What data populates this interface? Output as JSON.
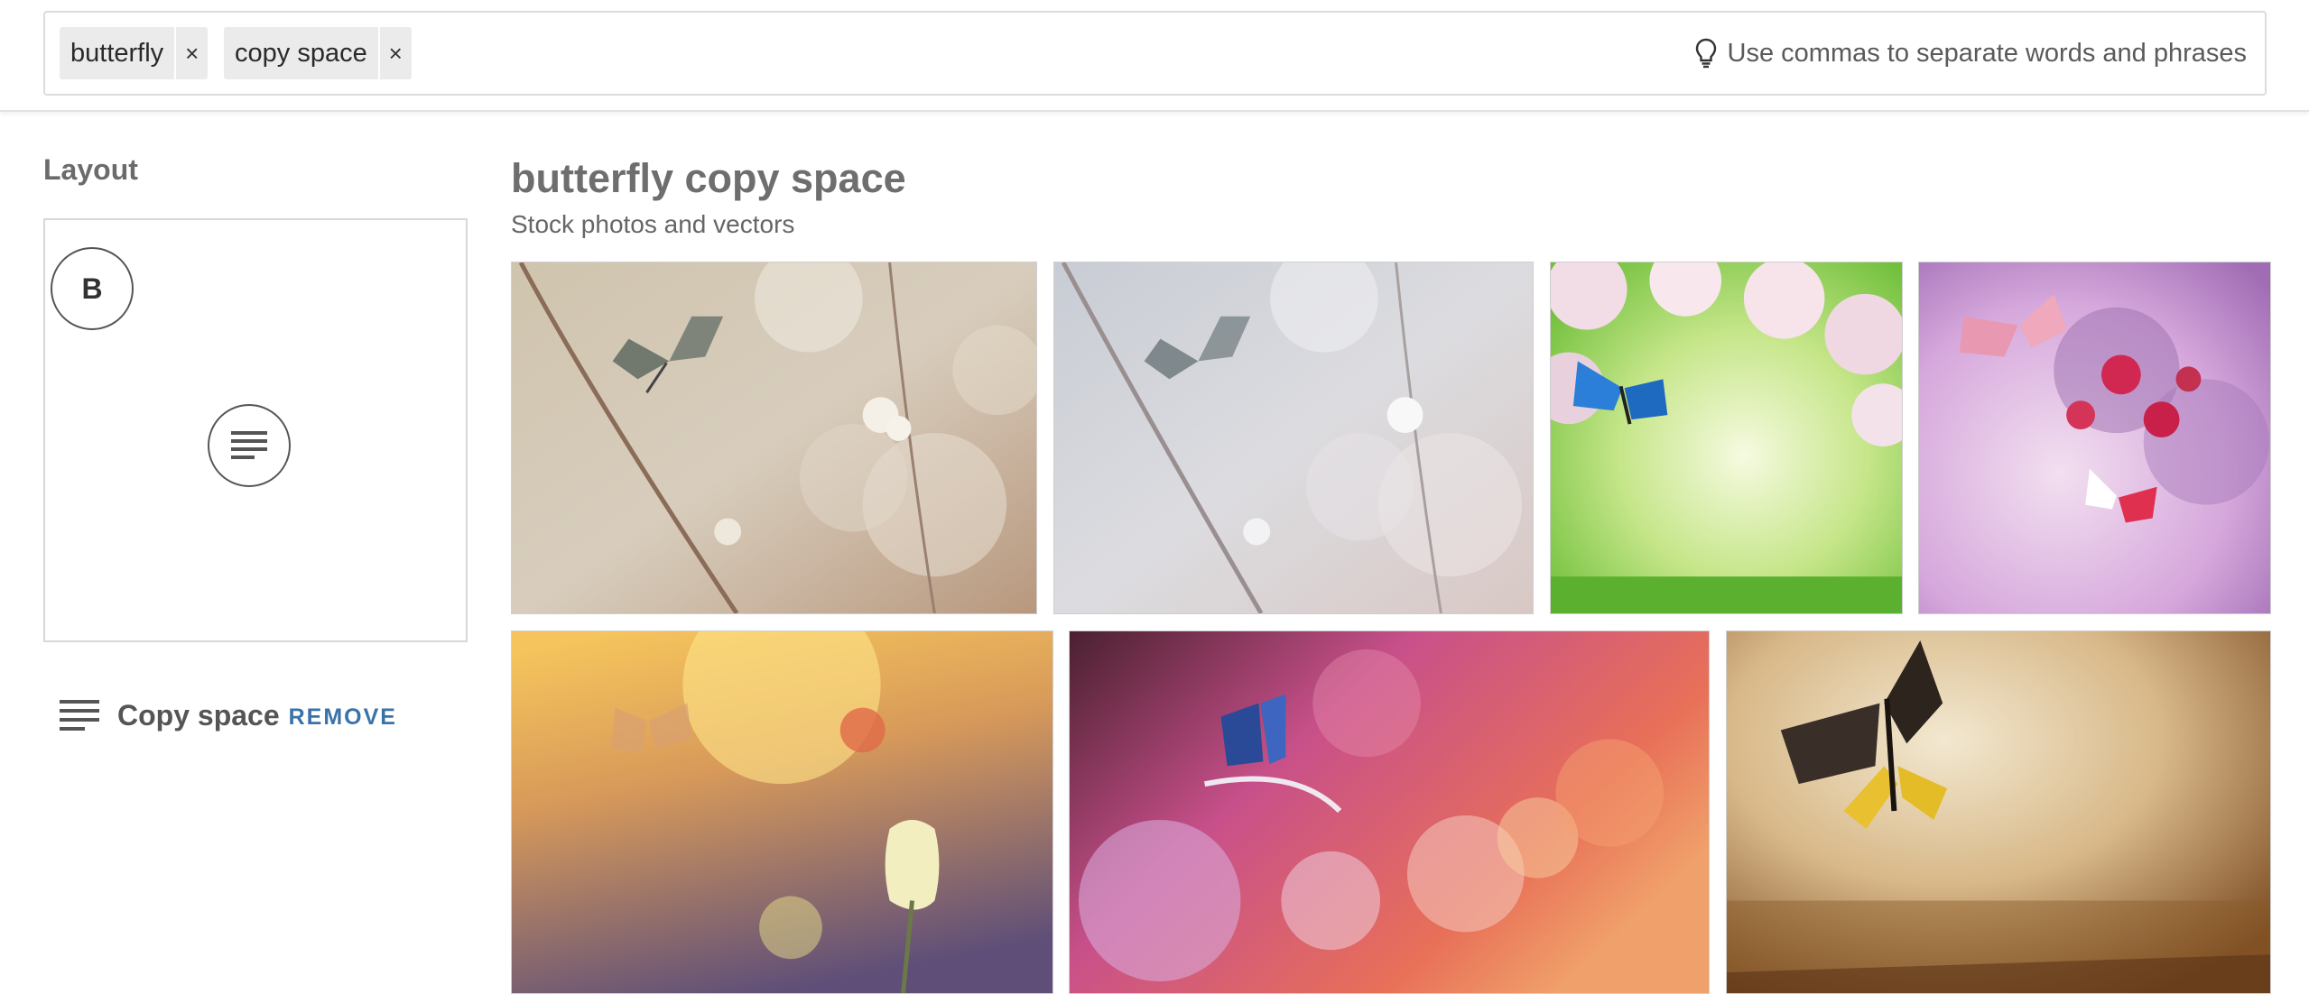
{
  "search": {
    "chips": [
      {
        "label": "butterfly",
        "remove": "×"
      },
      {
        "label": "copy space",
        "remove": "×"
      }
    ],
    "hint": "Use commas to separate words and phrases",
    "hint_icon": "lightbulb-icon"
  },
  "sidebar": {
    "layout_title": "Layout",
    "circle_b_label": "B",
    "copy_space_label": "Copy space",
    "remove_label": "REMOVE"
  },
  "main": {
    "title": "butterfly copy space",
    "subtitle": "Stock photos and vectors"
  },
  "images": [
    {
      "name": "butterfly-branch-warm",
      "desc": "butterfly on blossom branch, beige bokeh"
    },
    {
      "name": "butterfly-branch-cool",
      "desc": "butterfly on blossom branch, pale blue bokeh"
    },
    {
      "name": "blue-butterfly-apple-blossom",
      "desc": "blue butterfly under apple blossom, green"
    },
    {
      "name": "butterflies-roses-lilac",
      "desc": "butterflies with roses and lilac, purple"
    },
    {
      "name": "butterfly-tulip-sunset",
      "desc": "butterfly and tulip at sunset"
    },
    {
      "name": "blue-butterfly-bokeh",
      "desc": "blue butterfly on pink bokeh"
    },
    {
      "name": "butterfly-grunge",
      "desc": "black and yellow butterfly on grunge background"
    }
  ]
}
